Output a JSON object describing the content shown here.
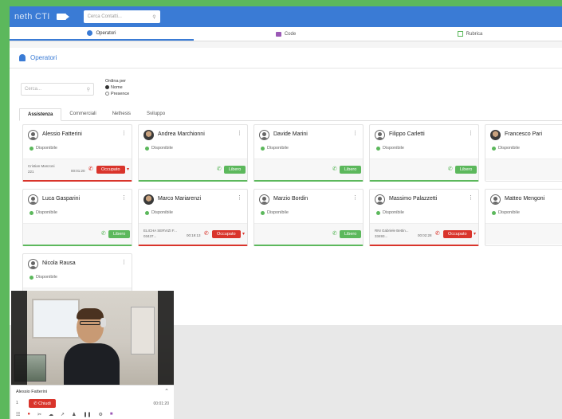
{
  "topbar": {
    "logo_main": "neth",
    "logo_sub": "CTI",
    "search_placeholder": "Cerca Contatti...",
    "search_icon": "search-icon"
  },
  "tabs": [
    {
      "label": "Operatori",
      "icon": "user-icon",
      "active": true
    },
    {
      "label": "Code",
      "icon": "queue-icon",
      "active": false
    },
    {
      "label": "Rubrica",
      "icon": "addressbook-icon",
      "active": false
    }
  ],
  "panel": {
    "title": "Operatori",
    "search_placeholder": "Cerca...",
    "order_label": "Ordina per",
    "order_options": [
      "Nome",
      "Presence"
    ],
    "group_tabs": [
      "Assistenza",
      "Commerciali",
      "Nethesis",
      "Sviluppo"
    ]
  },
  "operators": [
    {
      "name": "Alessio Fatterini",
      "status": "Disponibile",
      "state": "busy",
      "badge": "Occupato",
      "call_name": "Cristian Manzoni",
      "call_num": "221",
      "call_time": "00:01:20"
    },
    {
      "name": "Andrea Marchionni",
      "status": "Disponibile",
      "state": "free",
      "badge": "Libero"
    },
    {
      "name": "Davide Marini",
      "status": "Disponibile",
      "state": "free",
      "badge": "Libero"
    },
    {
      "name": "Filippo Carletti",
      "status": "Disponibile",
      "state": "free",
      "badge": "Libero"
    },
    {
      "name": "Francesco Pari",
      "status": "Disponibile",
      "state": "free",
      "badge": ""
    },
    {
      "name": "Luca Gasparini",
      "status": "Disponibile",
      "state": "free",
      "badge": "Libero"
    },
    {
      "name": "Marco Mariarenzi",
      "status": "Disponibile",
      "state": "busy",
      "badge": "Occupato",
      "call_name": "ELICHA SERVIZI F...",
      "call_num": "03437...",
      "call_time": "00:19:13"
    },
    {
      "name": "Marzio Bordin",
      "status": "Disponibile",
      "state": "free",
      "badge": "Libero"
    },
    {
      "name": "Massimo Palazzetti",
      "status": "Disponibile",
      "state": "busy",
      "badge": "Occupato",
      "call_name": "RNI Gabriele Bettin...",
      "call_num": "33493...",
      "call_time": "00:02:28"
    },
    {
      "name": "Matteo Mengoni",
      "status": "Disponibile",
      "state": "free",
      "badge": ""
    },
    {
      "name": "Nicola Rausa",
      "status": "Disponibile",
      "state": "free",
      "badge": ""
    }
  ],
  "call": {
    "name": "Alessio Fatterini",
    "number": "1",
    "hangup": "Chiudi",
    "time": "00:01:20"
  }
}
